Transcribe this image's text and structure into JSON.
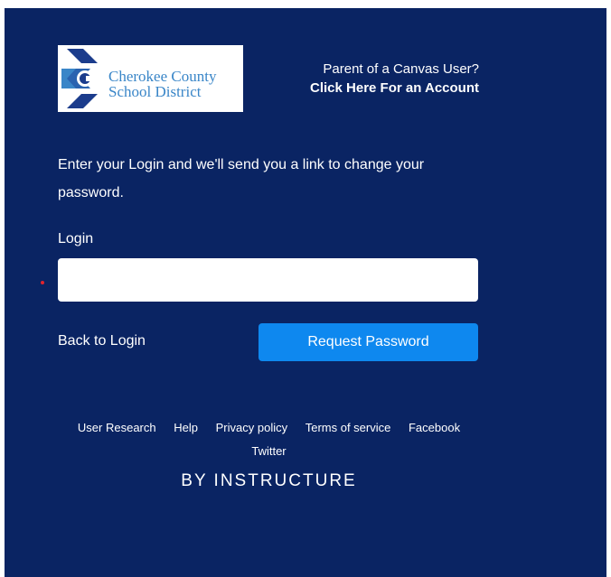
{
  "logo": {
    "line1": "Cherokee County",
    "line2": "School District"
  },
  "parent_link": {
    "line1": "Parent of a Canvas User?",
    "line2": "Click Here For an Account"
  },
  "instructions": "Enter your Login and we'll send you a link to change your password.",
  "login": {
    "label": "Login",
    "value": "",
    "placeholder": ""
  },
  "actions": {
    "back_label": "Back to Login",
    "request_label": "Request Password"
  },
  "footer": {
    "links": [
      "User Research",
      "Help",
      "Privacy policy",
      "Terms of service",
      "Facebook",
      "Twitter"
    ]
  },
  "brand": "BY INSTRUCTURE",
  "colors": {
    "background": "#0a2463",
    "button": "#0e88ef",
    "logo_dark": "#1b3c8c",
    "logo_light": "#3a86c8",
    "required_dot": "#e0242d"
  }
}
